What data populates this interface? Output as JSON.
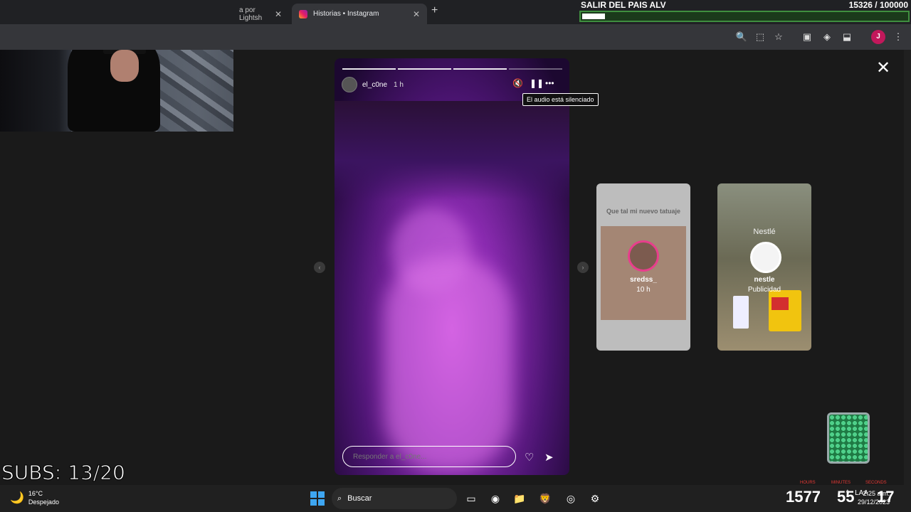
{
  "browser": {
    "tabs": [
      {
        "label": "a por Lightsh",
        "active": false
      },
      {
        "label": "Historias • Instagram",
        "active": true
      }
    ],
    "new_tab": "+"
  },
  "goal": {
    "name": "SALIR DEL PAIS ALV",
    "count": "15326 / 100000",
    "progress_fraction": 0.153
  },
  "story": {
    "username": "el_c0ne",
    "time": "1 h",
    "muted_tooltip": "El audio está silenciado",
    "reply_placeholder": "Responder a el_c0ne...",
    "segments": 4,
    "segments_filled": 3
  },
  "previews": [
    {
      "title": "Que tal mi nuevo tatuaje",
      "username": "sredss_",
      "time": "10 h"
    },
    {
      "brand": "Nestlé",
      "username": "nestle",
      "sublabel": "Publicidad"
    }
  ],
  "overlay": {
    "subs": "SUBS: 13/20",
    "counters": [
      "1577",
      "55",
      "17"
    ],
    "counter_labels": [
      "HOURS",
      "MINUTES",
      "SECONDS"
    ]
  },
  "taskbar": {
    "temperature": "16°C",
    "condition": "Despejado",
    "search_label": "Buscar",
    "time": "2:25 a.m.",
    "date": "29/12/2023",
    "lang": "LAA"
  },
  "colors": {
    "goal_border": "#3f8f3f",
    "story_purple": "#8a2bb0",
    "accent_pink": "#e83e8c"
  }
}
